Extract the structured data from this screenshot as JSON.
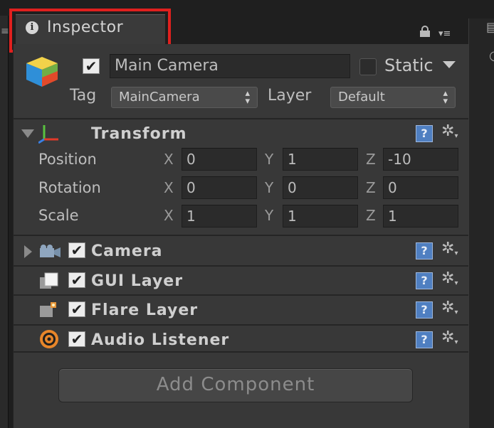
{
  "tab": {
    "label": "Inspector",
    "icon": "info-icon"
  },
  "header": {
    "active": true,
    "object_name": "Main Camera",
    "static_label": "Static",
    "tag_label": "Tag",
    "tag_value": "MainCamera",
    "layer_label": "Layer",
    "layer_value": "Default"
  },
  "transform": {
    "title": "Transform",
    "rows": [
      {
        "label": "Position",
        "x": "0",
        "y": "1",
        "z": "-10"
      },
      {
        "label": "Rotation",
        "x": "0",
        "y": "0",
        "z": "0"
      },
      {
        "label": "Scale",
        "x": "1",
        "y": "1",
        "z": "1"
      }
    ],
    "axis_x": "X",
    "axis_y": "Y",
    "axis_z": "Z"
  },
  "components": [
    {
      "title": "Camera",
      "icon": "camera-icon",
      "enabled": true
    },
    {
      "title": "GUI Layer",
      "icon": "gui-layer-icon",
      "enabled": true
    },
    {
      "title": "Flare Layer",
      "icon": "flare-layer-icon",
      "enabled": true
    },
    {
      "title": "Audio Listener",
      "icon": "audio-listener-icon",
      "enabled": true
    }
  ],
  "add_component_label": "Add Component",
  "colors": {
    "highlight": "#e0201e",
    "panel": "#383838",
    "help_icon": "#4f7fc1"
  }
}
